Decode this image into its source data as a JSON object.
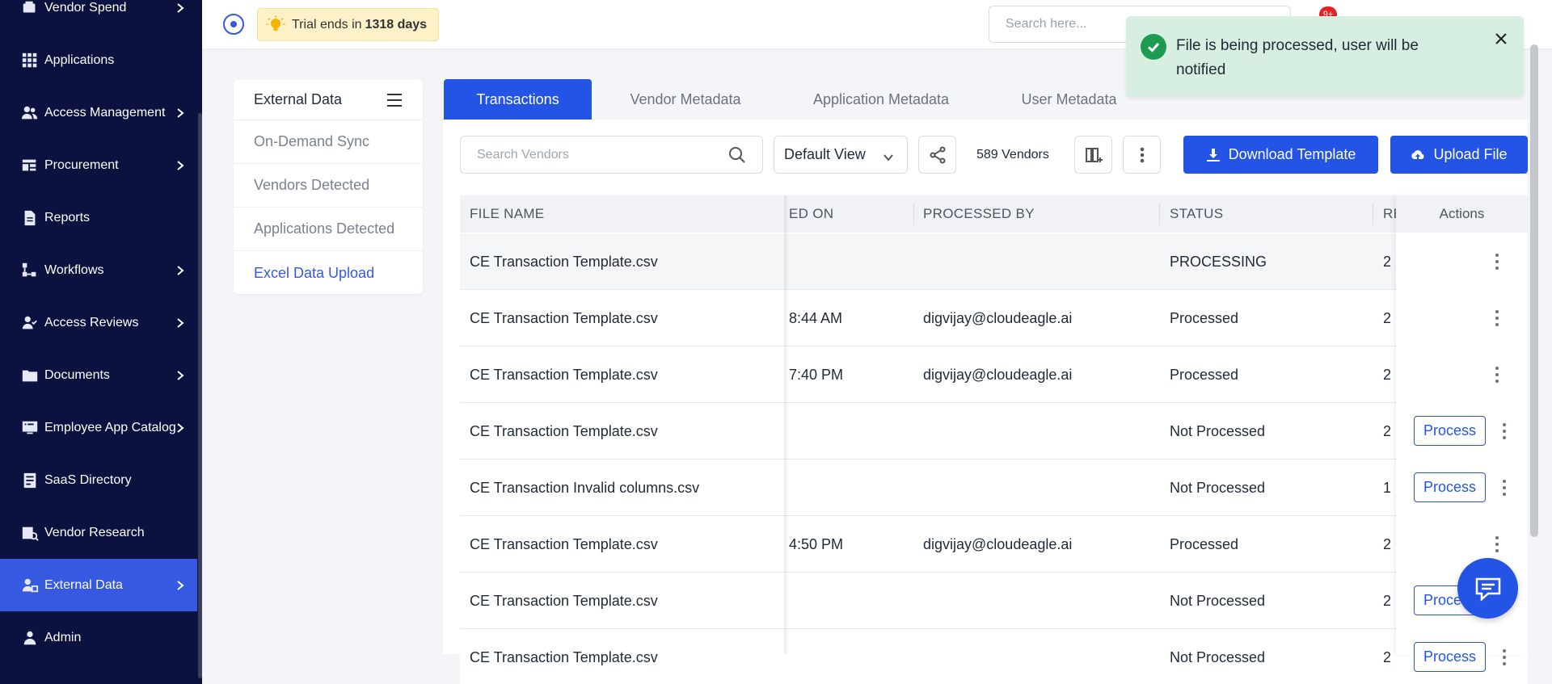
{
  "sidebar": {
    "items": [
      {
        "label": "Vendor Spend",
        "icon": "vendor-spend-icon",
        "chevron": true
      },
      {
        "label": "Applications",
        "icon": "grid-icon",
        "chevron": false
      },
      {
        "label": "Access Management",
        "icon": "users-icon",
        "chevron": true
      },
      {
        "label": "Procurement",
        "icon": "procurement-icon",
        "chevron": true
      },
      {
        "label": "Reports",
        "icon": "document-icon",
        "chevron": false
      },
      {
        "label": "Workflows",
        "icon": "workflow-icon",
        "chevron": true
      },
      {
        "label": "Access Reviews",
        "icon": "user-check-icon",
        "chevron": true
      },
      {
        "label": "Documents",
        "icon": "folder-icon",
        "chevron": true
      },
      {
        "label": "Employee App Catalog",
        "icon": "catalog-icon",
        "chevron": true
      },
      {
        "label": "SaaS Directory",
        "icon": "directory-icon",
        "chevron": false
      },
      {
        "label": "Vendor Research",
        "icon": "vendor-research-icon",
        "chevron": false
      },
      {
        "label": "External Data",
        "icon": "external-data-icon",
        "chevron": true,
        "active": true
      },
      {
        "label": "Admin",
        "icon": "admin-icon",
        "chevron": false
      }
    ]
  },
  "topbar": {
    "trial_prefix": "Trial ends in",
    "trial_days": "1318 days",
    "search_placeholder": "Search here...",
    "notification_count": "9+"
  },
  "toast": {
    "message": "File is being processed, user will be notified"
  },
  "subnav": {
    "title": "External Data",
    "items": [
      "On-Demand Sync",
      "Vendors Detected",
      "Applications Detected",
      "Excel Data Upload"
    ],
    "active": "Excel Data Upload"
  },
  "tabs": [
    "Transactions",
    "Vendor Metadata",
    "Application Metadata",
    "User Metadata"
  ],
  "toolbar": {
    "search_placeholder": "Search Vendors",
    "view": "Default View",
    "count": "589 Vendors",
    "download_label": "Download Template",
    "upload_label": "Upload File"
  },
  "table": {
    "headers": {
      "file_name": "FILE NAME",
      "processed_on": "ED ON",
      "processed_by": "PROCESSED BY",
      "status": "STATUS",
      "records": "RE",
      "actions": "Actions"
    },
    "process_label": "Process",
    "rows": [
      {
        "file": "CE Transaction Template.csv",
        "time": "",
        "by": "",
        "status": "PROCESSING",
        "rec": "2",
        "process": false
      },
      {
        "file": "CE Transaction Template.csv",
        "time": "8:44 AM",
        "by": "digvijay@cloudeagle.ai",
        "status": "Processed",
        "rec": "2",
        "process": false
      },
      {
        "file": "CE Transaction Template.csv",
        "time": "7:40 PM",
        "by": "digvijay@cloudeagle.ai",
        "status": "Processed",
        "rec": "2",
        "process": false
      },
      {
        "file": "CE Transaction Template.csv",
        "time": "",
        "by": "",
        "status": "Not Processed",
        "rec": "2",
        "process": true
      },
      {
        "file": "CE Transaction Invalid columns.csv",
        "time": "",
        "by": "",
        "status": "Not Processed",
        "rec": "1",
        "process": true
      },
      {
        "file": "CE Transaction Template.csv",
        "time": "4:50 PM",
        "by": "digvijay@cloudeagle.ai",
        "status": "Processed",
        "rec": "2",
        "process": false
      },
      {
        "file": "CE Transaction Template.csv",
        "time": "",
        "by": "",
        "status": "Not Processed",
        "rec": "2",
        "process": true
      },
      {
        "file": "CE Transaction Template.csv",
        "time": "",
        "by": "",
        "status": "Not Processed",
        "rec": "2",
        "process": true
      }
    ]
  },
  "colors": {
    "sidebar_bg": "#0b1240",
    "accent": "#2454e6",
    "toast_bg": "#d6efe0",
    "trial_bg": "#fdf1c7"
  }
}
